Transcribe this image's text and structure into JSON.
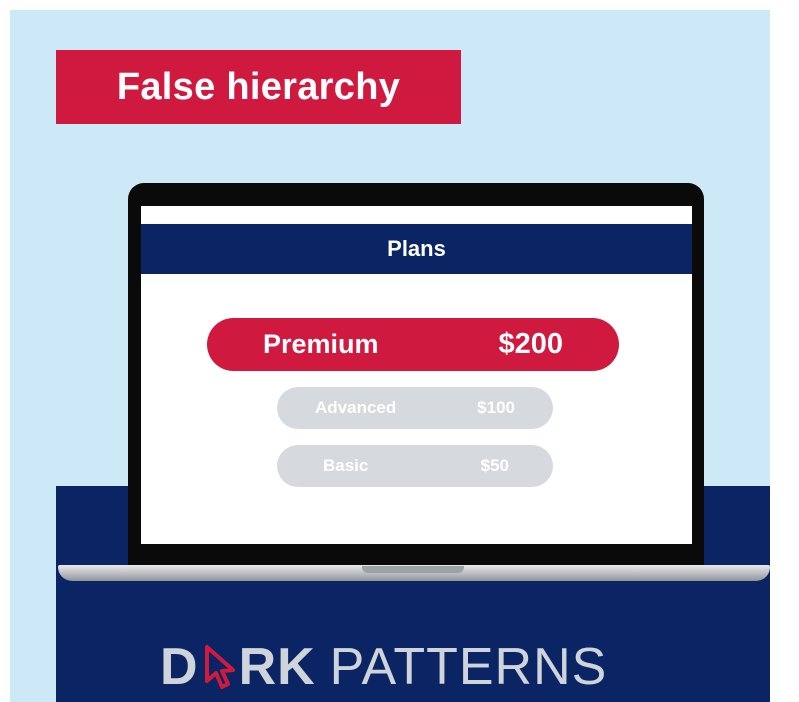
{
  "banner": {
    "text": "False hierarchy"
  },
  "screen": {
    "header_title": "Plans",
    "plans": [
      {
        "name": "Premium",
        "price": "$200"
      },
      {
        "name": "Advanced",
        "price": "$100"
      },
      {
        "name": "Basic",
        "price": "$50"
      }
    ]
  },
  "brand": {
    "text_dark_first": "D",
    "text_dark_last": "RK",
    "text_patterns": "PATTERNS",
    "icon": "cursor-arrow-icon"
  },
  "colors": {
    "accent_red": "#d0193f",
    "navy": "#0b2463",
    "sky": "#cde8f7",
    "muted_gray": "#d6d9de"
  }
}
